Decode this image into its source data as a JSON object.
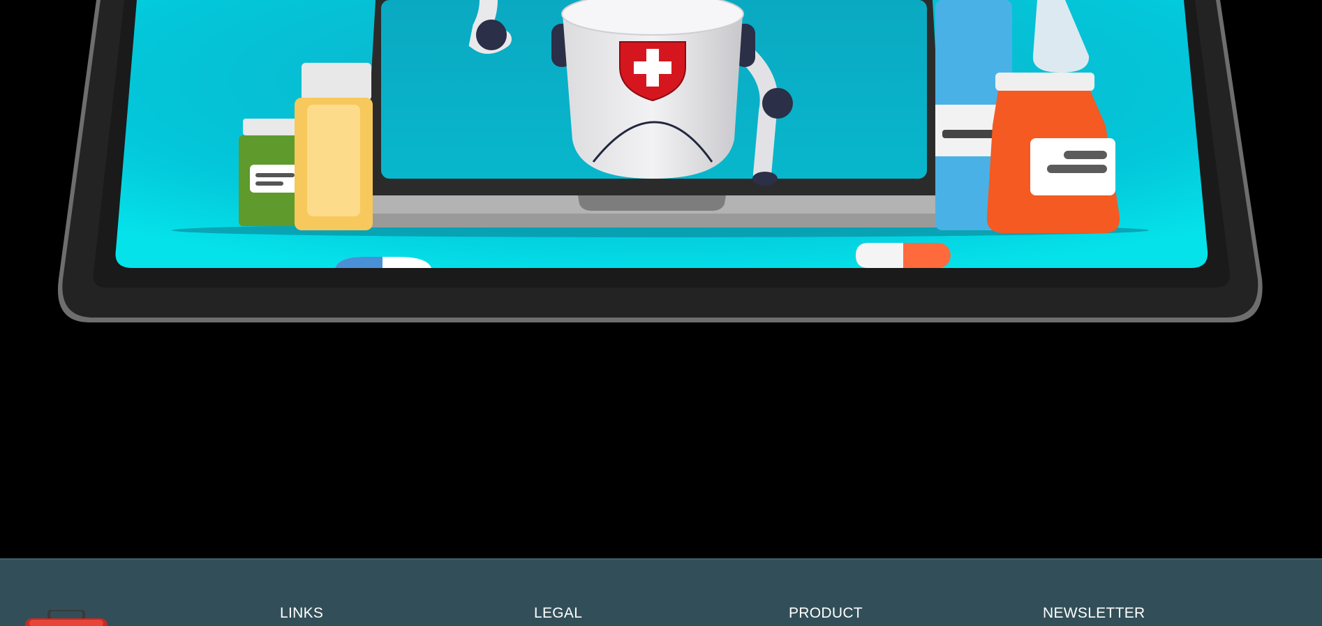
{
  "hero": {
    "illustration": "telemedicine-robot-tablet-illustration",
    "colors": {
      "screen": "#04c9dc",
      "tablet_frame": "#1f1f1f",
      "tablet_edge": "#6b6b6b",
      "background": "#000000"
    }
  },
  "footer": {
    "background": "#324f59",
    "logo_icon": "first-aid-kit-icon",
    "columns": [
      {
        "heading": "LINKS"
      },
      {
        "heading": "LEGAL"
      },
      {
        "heading": "PRODUCT"
      },
      {
        "heading": "NEWSLETTER"
      }
    ]
  }
}
